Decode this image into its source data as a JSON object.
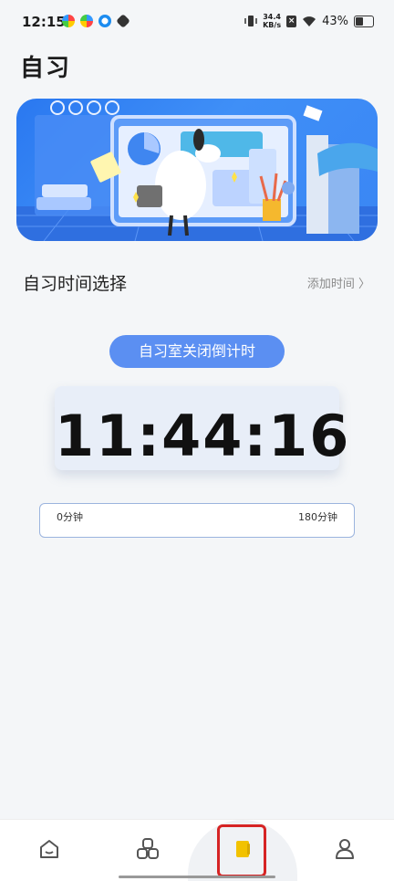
{
  "status_bar": {
    "time": "12:15",
    "net_speed_value": "34.4",
    "net_speed_unit": "KB/s",
    "battery": "43%"
  },
  "page": {
    "title": "自习"
  },
  "section": {
    "title": "自习时间选择",
    "add_time_link": "添加时间 〉"
  },
  "countdown": {
    "label": "自习室关闭倒计时",
    "time": "11:44:16"
  },
  "slider": {
    "min_label": "0分钟",
    "max_label": "180分钟"
  },
  "nav": {
    "items": [
      "home-icon",
      "apps-icon",
      "notes-icon",
      "profile-icon"
    ],
    "selected": "notes-icon"
  },
  "colors": {
    "accent": "#5b8ff2",
    "banner": "#3a86f4",
    "selected_icon": "#f2c200",
    "annotation": "#d62424"
  }
}
